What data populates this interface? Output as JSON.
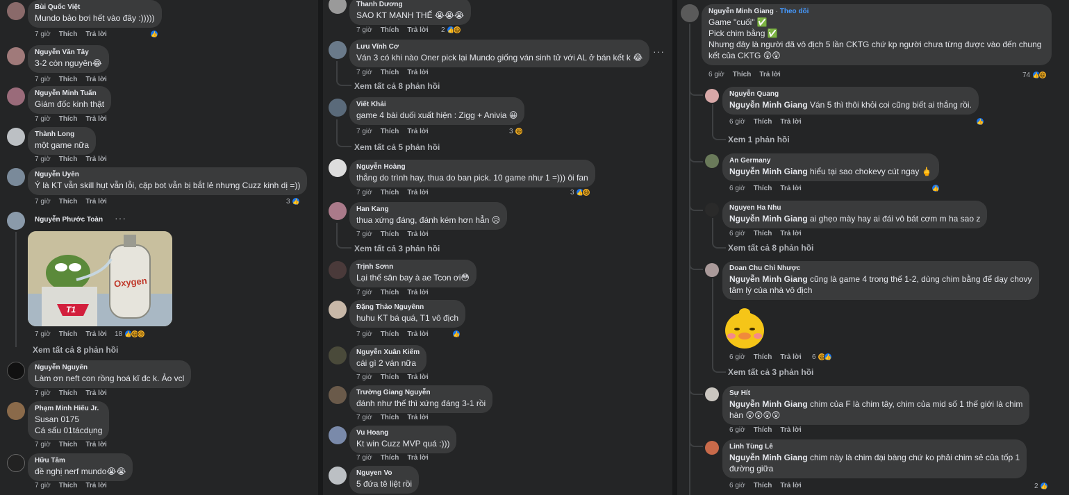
{
  "labels": {
    "time7": "7 giờ",
    "time6": "6 giờ",
    "like": "Thích",
    "reply": "Trả lời",
    "follow": "Theo dõi",
    "sep": " · "
  },
  "p1": [
    {
      "name": "Bùi Quốc Việt",
      "text": "Mundo bảo bơi hết vào đây :)))))",
      "react": ""
    },
    {
      "name": "Nguyễn Văn Tây",
      "text": "3-2 còn nguyên😂",
      "react": ""
    },
    {
      "name": "Nguyễn Minh Tuấn",
      "text": "Giám đốc kinh thật",
      "react": ""
    },
    {
      "name": "Thành Long",
      "text": "một game nữa",
      "react": ""
    },
    {
      "name": "Nguyễn Uyên",
      "text": "Ý là KT vẫn skill hụt vẫn lỗi, cặp bot vẫn bị bắt lẻ nhưng Cuzz kinh dị =))",
      "react": "3"
    },
    {
      "name": "Nguyễn Phước Toàn",
      "text": "",
      "react": "18"
    },
    {
      "name": "Nguyễn Nguyên",
      "text": "Làm ơn neft con rồng hoá kĩ đc k. Ảo vcl",
      "react": ""
    },
    {
      "name": "Phạm Minh Hiếu Jr.",
      "text": "Susan 0175",
      "text2": "Cá sấu 01tácdụng",
      "react": ""
    },
    {
      "name": "Hữu Tâm",
      "text": "đề nghị nerf mundo😭😭",
      "react": ""
    }
  ],
  "p1_extra": {
    "more": "Xem tất cả 8 phản hồi",
    "oxygen": "Oxygen",
    "t1": "T1"
  },
  "p2": [
    {
      "name": "Thanh Dương",
      "text": "SAO KT MẠNH THẾ 😭😭😭",
      "react": "2"
    },
    {
      "name": "Lưu Vĩnh Cơ",
      "text": "Ván 3 có khi nào Oner pick lại Mundo giống ván sinh tử với AL ở bán kết k 😂",
      "react": "",
      "more": "Xem tất cả 8 phản hồi"
    },
    {
      "name": "Viết Khải",
      "text": "game 4 bài duối xuất hiện : Zigg + Anivia 😀",
      "react": "3",
      "more": "Xem tất cả 5 phản hồi"
    },
    {
      "name": "Nguyễn Hoàng",
      "text": "thắng do trình hay, thua do ban pick. 10 game như 1 =))) ôi fan",
      "react": "3"
    },
    {
      "name": "Han Kang",
      "text": "thua xứng đáng, đánh kém hơn hẳn 😥",
      "react": "",
      "more": "Xem tất cả 3 phản hồi"
    },
    {
      "name": "Trịnh Sơnn",
      "text": "Lại thế sân bay à ae Tcon ơi😳",
      "react": ""
    },
    {
      "name": "Đặng Thảo Nguyênn",
      "text": "huhu KT bá quá, T1 vô địch",
      "react": ""
    },
    {
      "name": "Nguyễn Xuân Kiếm",
      "text": "cái gì 2 ván nữa",
      "react": ""
    },
    {
      "name": "Trường Giang Nguyễn",
      "text": "đánh như thế thì xứng đáng 3-1 rồi",
      "react": ""
    },
    {
      "name": "Vu Hoang",
      "text": "Kt win Cuzz MVP quá :)))",
      "react": ""
    },
    {
      "name": "Nguyen Vo",
      "text": "5 đứa tê liệt rồi",
      "react": ""
    }
  ],
  "p3_main": {
    "name": "Nguyễn Minh Giang",
    "line1": "Game \"cuối\" ✅",
    "line2": "Pick chim bằng ✅",
    "line3": "Nhưng đây là người đã vô địch 5 lần CKTG chứ kp người chưa từng được vào đến chung",
    "line4": "kết của CKTG 😲😲",
    "react": "74"
  },
  "p3": [
    {
      "name": "Nguyễn Quang",
      "tag": "Nguyễn Minh Giang",
      "text": " Ván 5 thì thôi khỏi coi cũng biết ai thắng rồi.",
      "react": "",
      "more": "Xem 1 phản hồi"
    },
    {
      "name": "An Germany",
      "tag": "Nguyễn Minh Giang",
      "text": " hiểu tại sao chokevy cút ngay 🖕",
      "react": ""
    },
    {
      "name": "Nguyen Ha Nhu",
      "tag": "Nguyễn Minh Giang",
      "text": " ai ghẹo mày hay ai đái vô bát cơm m ha sao z",
      "react": "",
      "more": "Xem tất cả 8 phản hồi"
    },
    {
      "name": "Doan Chu Chỉ Nhược",
      "tag": "Nguyễn Minh Giang",
      "text": " cũng là game 4 trong thế 1-2, dùng chim bằng để dạy chovy",
      "text2": "tâm lý của nhà vô địch",
      "react": "6",
      "more": "Xem tất cả 3 phản hồi"
    },
    {
      "name": "Sự Hít",
      "tag": "Nguyễn Minh Giang",
      "text": " chim của F là chim tây, chim của mid số 1 thế giới là chim",
      "text2": "hàn 😲😲😲😲",
      "react": ""
    },
    {
      "name": "Linh Tùng Lê",
      "tag": "Nguyễn Minh Giang",
      "text": " chim này là chim đại bàng chứ ko phải chim sẻ của tốp 1",
      "text2": "đường giữa",
      "react": "2"
    }
  ],
  "icons": {
    "like": "like-icon",
    "haha": "haha-icon",
    "dots": "more-options-icon"
  }
}
